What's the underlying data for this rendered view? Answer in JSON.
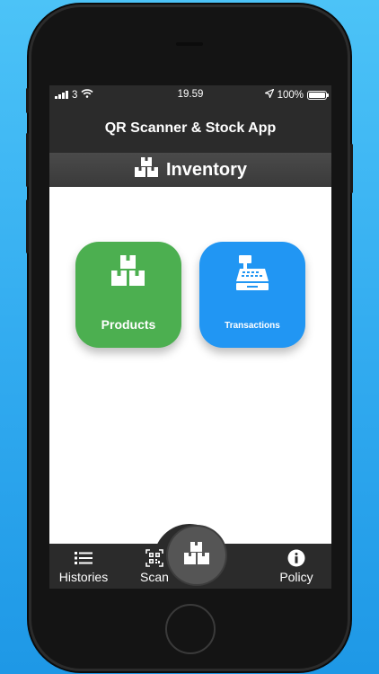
{
  "status_bar": {
    "carrier": "3",
    "time": "19.59",
    "battery": "100%",
    "icons": [
      "signal-icon",
      "wifi-icon",
      "location-arrow-icon",
      "battery-icon"
    ]
  },
  "header": {
    "title": "QR Scanner & Stock App"
  },
  "section": {
    "title": "Inventory",
    "icon": "boxes-icon"
  },
  "tiles": [
    {
      "label": "Products",
      "icon": "boxes-icon",
      "color": "#4caf50"
    },
    {
      "label": "Transactions",
      "icon": "cash-register-icon",
      "color": "#2196f3"
    }
  ],
  "tabbar": {
    "histories": {
      "label": "Histories",
      "icon": "list-icon"
    },
    "scan": {
      "label": "Scan",
      "icon": "qr-code-icon"
    },
    "inventory": {
      "icon": "boxes-icon"
    },
    "policy": {
      "label": "Policy",
      "icon": "info-circle-icon"
    }
  },
  "colors": {
    "bar_background": "#2b2b2b",
    "background_gradient_top": "#4cc3f7",
    "background_gradient_bottom": "#1e98e6"
  }
}
